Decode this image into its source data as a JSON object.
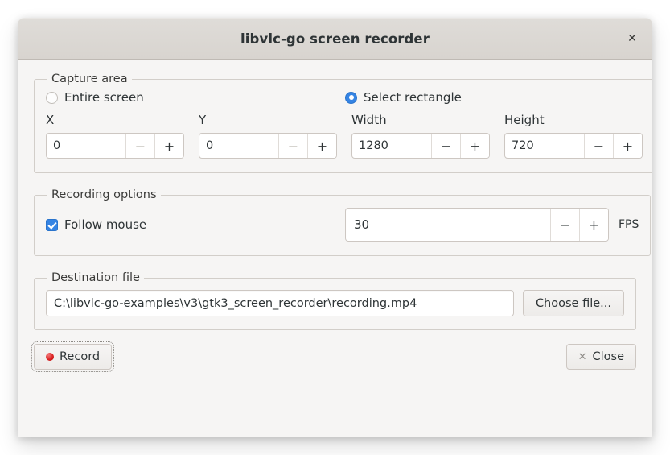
{
  "window": {
    "title": "libvlc-go screen recorder",
    "close_icon": "close-icon",
    "close_glyph": "✕"
  },
  "capture_area": {
    "legend": "Capture area",
    "options": [
      {
        "label": "Entire screen",
        "selected": false
      },
      {
        "label": "Select rectangle",
        "selected": true
      }
    ],
    "fields": [
      {
        "label": "X",
        "value": "0",
        "minus": "−",
        "plus": "+",
        "minus_disabled": true
      },
      {
        "label": "Y",
        "value": "0",
        "minus": "−",
        "plus": "+",
        "minus_disabled": true
      },
      {
        "label": "Width",
        "value": "1280",
        "minus": "−",
        "plus": "+",
        "minus_disabled": false
      },
      {
        "label": "Height",
        "value": "720",
        "minus": "−",
        "plus": "+",
        "minus_disabled": false
      }
    ]
  },
  "recording_options": {
    "legend": "Recording options",
    "follow_mouse": {
      "label": "Follow mouse",
      "checked": true
    },
    "fps": {
      "value": "30",
      "unit": "FPS",
      "minus": "−",
      "plus": "+"
    }
  },
  "destination": {
    "legend": "Destination file",
    "path": "C:\\libvlc-go-examples\\v3\\gtk3_screen_recorder\\recording.mp4",
    "placeholder": "",
    "choose_button": "Choose file..."
  },
  "actions": {
    "record": {
      "label": "Record",
      "icon": "record-dot-icon"
    },
    "close": {
      "label": "Close",
      "icon": "close-icon",
      "glyph": "✕"
    }
  },
  "colors": {
    "accent": "#3584e4",
    "record_red": "#d81b1b",
    "headerbar": "#d8d4cf",
    "window_bg": "#f6f5f4"
  }
}
